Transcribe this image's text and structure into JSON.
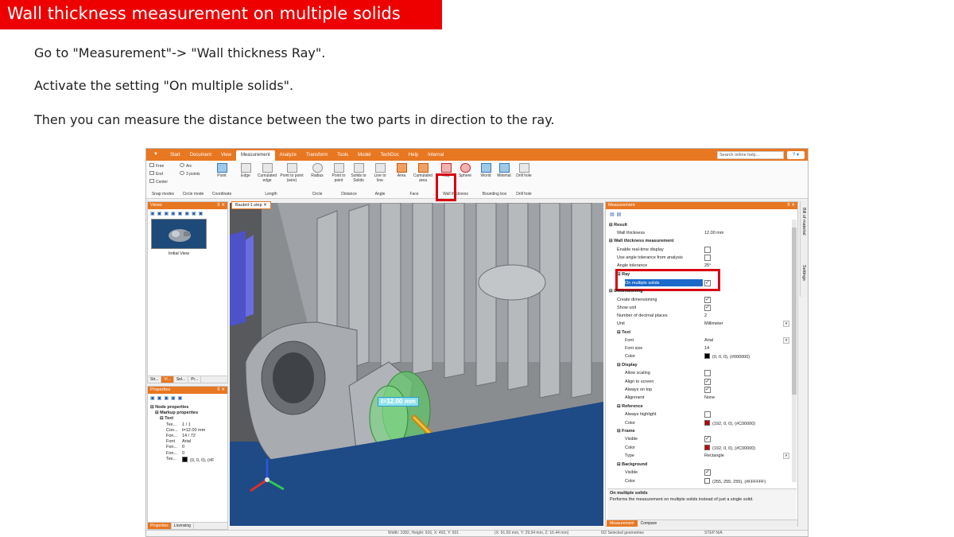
{
  "slide": {
    "title": "Wall thickness measurement on multiple solids",
    "steps": [
      "Go to \"Measurement\"-> \"Wall thickness Ray\".",
      "Activate the setting \"On multiple solids\".",
      "Then you can measure the distance between the two parts in direction to the ray."
    ]
  },
  "app": {
    "menu_tabs": [
      "Start",
      "Document",
      "View",
      "Measurement",
      "Analyze",
      "Transform",
      "Tools",
      "Model",
      "TechDoc",
      "Help",
      "Internal"
    ],
    "active_tab": "Measurement",
    "search_placeholder": "Search online help...",
    "ribbon": {
      "snap": {
        "free": "Free",
        "end": "End",
        "center": "Center",
        "arc": "Arc",
        "three_points": "3 points",
        "point": "Point"
      },
      "groups": {
        "snap_modes": "Snap modes",
        "circle_mode": "Circle mode",
        "coordinate": "Coordinate",
        "length": "Length",
        "circle": "Circle",
        "distance": "Distance",
        "angle": "Angle",
        "face": "Face",
        "wall_thickness": "Wall thickness",
        "bounding_box": "Bounding box",
        "drill_hole": "Drill hole"
      },
      "buttons": {
        "edge": "Edge",
        "cumulated_edge": "Cumulated edge",
        "point_to_point_wire": "Point to point (wire)",
        "radius": "Radius",
        "point_to_point": "Point to point",
        "solids_to_solids": "Solids to Solids",
        "line_to_line": "Line to line",
        "area": "Area",
        "cumulated_area": "Cumulated area",
        "ray": "Ray",
        "sphere": "Sphere",
        "world": "World",
        "minimal": "Minimal",
        "drill_hole": "Drill hole"
      }
    },
    "views_panel": {
      "title": "Views",
      "thumb_label": "Initial View",
      "tabs": [
        "Str...",
        "Vi...",
        "Sel...",
        "Pr..."
      ]
    },
    "properties_panel": {
      "title": "Properties",
      "rows": [
        {
          "k": "Node properties",
          "v": ""
        },
        {
          "k": "Markup properties",
          "v": ""
        },
        {
          "k": "Text",
          "v": ""
        },
        {
          "k": "Tex...",
          "v": "1 / 1"
        },
        {
          "k": "Con...",
          "v": "t=12.00 mm"
        },
        {
          "k": "Fon...",
          "v": "14 / 72"
        },
        {
          "k": "Font",
          "v": "Arial"
        },
        {
          "k": "Fon...",
          "v": "0"
        },
        {
          "k": "Fon...",
          "v": "0"
        },
        {
          "k": "Tex...",
          "v": "(0, 0, 0), (#F"
        }
      ],
      "tabs": [
        "Properties",
        "Licensing"
      ]
    },
    "document_tab": "Bauteil-1.step",
    "measure_label": "t=12.00 mm",
    "measurement_panel": {
      "title": "Measurement",
      "side_tabs": [
        "Bill of material",
        "Settings"
      ],
      "result_header": "Result",
      "wall_thickness_label": "Wall thickness",
      "wall_thickness_value": "12.00 mm",
      "wtm_header": "Wall thickness measurement",
      "enable_realtime": "Enable real-time display",
      "use_angle_tol": "Use angle tolerance from analysis",
      "angle_tol_label": "Angle tolerance",
      "angle_tol_value": "25°",
      "ray_header": "Ray",
      "on_multiple_solids": "On multiple solids",
      "dimensioning_header": "Dimensioning",
      "create_dim": "Create dimensioning",
      "show_unit": "Show unit",
      "decimal_places": "Number of decimal places",
      "decimal_value": "2",
      "unit": "Unit",
      "unit_value": "Millimeter",
      "text_header": "Text",
      "font": "Font",
      "font_value": "Arial",
      "font_size": "Font size",
      "font_size_value": "14",
      "color": "Color",
      "text_color_value": "(0, 0, 0), (#000000)",
      "display_header": "Display",
      "allow_scaling": "Allow scaling",
      "align_screen": "Align to screen",
      "always_top": "Always on top",
      "alignment": "Alignment",
      "alignment_value": "None",
      "reference_header": "Reference",
      "always_highlight": "Always highlight",
      "ref_color_value": "(192, 0, 0), (#C00000)",
      "frame_header": "Frame",
      "visible": "Visible",
      "frame_color_value": "(192, 0, 0), (#C00000)",
      "type": "Type",
      "type_value": "Rectangle",
      "background_header": "Background",
      "bg_color_value": "(255, 255, 255), (#FFFFFF)",
      "help_title": "On multiple solids",
      "help_text": "Performs the measurement on multiple solids instead of just a single solid.",
      "tabs": [
        "Measurement",
        "Compare"
      ]
    },
    "status": {
      "dims": "Width: 1082, Height: 916, X: 492, Y: 601",
      "coords": "(X: 91.50 mm, Y: 29.34 mm, Z: 16.44 mm)",
      "selection": "0/2 Selected geometries",
      "step": "STEP N/A"
    },
    "colors": {
      "accent": "#e87722",
      "highlight": "#d80010",
      "title_bar": "#ee0000",
      "selection": "#1b6ac9"
    }
  }
}
